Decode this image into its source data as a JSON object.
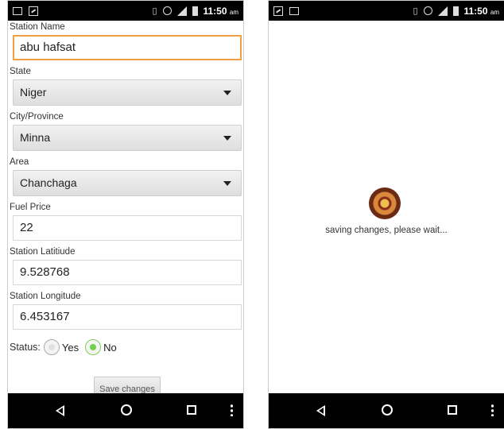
{
  "left_screen": {
    "status_time": "11:50",
    "status_ampm": "am",
    "fields": {
      "station_name": {
        "label": "Station Name",
        "value": "abu hafsat"
      },
      "state": {
        "label": "State",
        "value": "Niger"
      },
      "city": {
        "label": "City/Province",
        "value": "Minna"
      },
      "area": {
        "label": "Area",
        "value": "Chanchaga"
      },
      "fuel_price": {
        "label": "Fuel Price",
        "value": "22"
      },
      "latitude": {
        "label": "Station Latitiude",
        "value": "9.528768"
      },
      "longitude": {
        "label": "Station Longitude",
        "value": "6.453167"
      }
    },
    "status": {
      "label": "Status:",
      "options": [
        {
          "label": "Yes",
          "selected": false
        },
        {
          "label": "No",
          "selected": true
        }
      ]
    },
    "save_button": "Save changes"
  },
  "right_screen": {
    "status_time": "11:50",
    "status_ampm": "am",
    "loading_text": "saving changes, please wait..."
  },
  "icons": [
    "back-icon",
    "home-icon",
    "recents-icon",
    "overflow-menu-icon",
    "roulette-spinner-icon"
  ],
  "colors": {
    "focus_border": "#f0a040",
    "radio_selected": "#6fd04a",
    "navbar": "#000000"
  }
}
